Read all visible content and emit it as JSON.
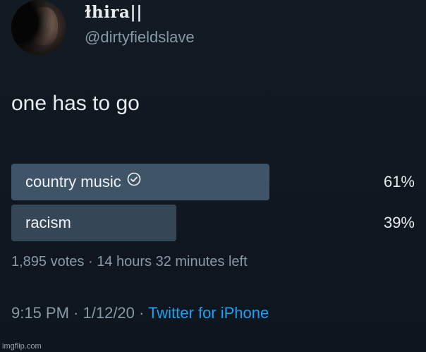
{
  "user": {
    "display_name": "ɫhira||",
    "handle": "@dirtyfieldslave"
  },
  "tweet": {
    "text": "one has to go"
  },
  "poll": {
    "options": [
      {
        "label": "country music",
        "percent_label": "61%",
        "percent": 61,
        "winner": true
      },
      {
        "label": "racism",
        "percent_label": "39%",
        "percent": 39,
        "winner": false
      }
    ],
    "votes": "1,895 votes",
    "separator": " · ",
    "time_left": "14 hours 32 minutes left",
    "winner_color": "#3f5466",
    "other_color": "#354656"
  },
  "meta": {
    "time": "9:15 PM",
    "date": "1/12/20",
    "separator": " · ",
    "source": "Twitter for iPhone"
  },
  "watermark": "imgflip.com",
  "icons": {
    "winner_check": "check-circle-icon"
  }
}
